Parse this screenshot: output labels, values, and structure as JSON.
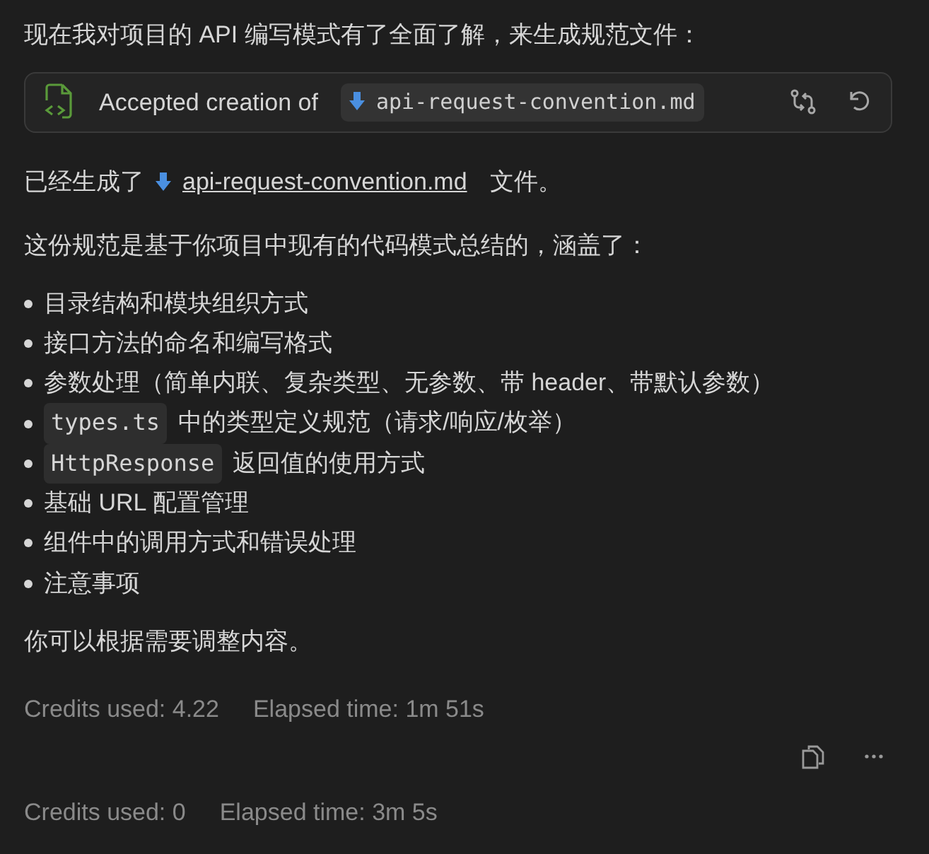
{
  "intro": "现在我对项目的 API 编写模式有了全面了解，来生成规范文件：",
  "action_card": {
    "label": "Accepted creation of",
    "file": "api-request-convention.md"
  },
  "generated": {
    "before": "已经生成了",
    "file": "api-request-convention.md",
    "after": "文件。"
  },
  "summary": "这份规范是基于你项目中现有的代码模式总结的，涵盖了：",
  "bullets": [
    {
      "text": "目录结构和模块组织方式"
    },
    {
      "text": "接口方法的命名和编写格式"
    },
    {
      "text": "参数处理（简单内联、复杂类型、无参数、带 header、带默认参数）"
    },
    {
      "code": "types.ts",
      "text": "中的类型定义规范（请求/响应/枚举）"
    },
    {
      "code": "HttpResponse",
      "text": "返回值的使用方式"
    },
    {
      "text": "基础 URL 配置管理"
    },
    {
      "text": "组件中的调用方式和错误处理"
    },
    {
      "text": "注意事项"
    }
  ],
  "closing": "你可以根据需要调整内容。",
  "stats": [
    {
      "credits": "Credits used: 4.22",
      "elapsed": "Elapsed time: 1m 51s"
    },
    {
      "credits": "Credits used: 0",
      "elapsed": "Elapsed time: 3m 5s"
    }
  ]
}
